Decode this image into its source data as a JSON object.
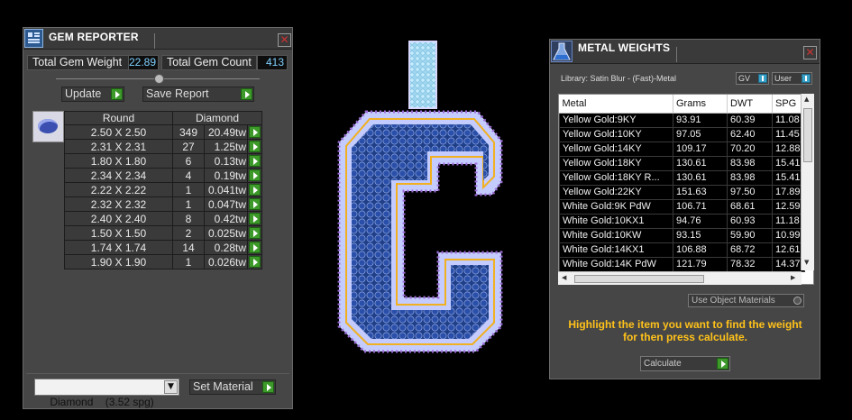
{
  "gem_reporter": {
    "title": "GEM REPORTER",
    "close_glyph": "✕",
    "total_weight_label": "Total Gem Weight",
    "total_weight_value": "22.89",
    "total_count_label": "Total Gem Count",
    "total_count_value": "413",
    "update_label": "Update",
    "save_report_label": "Save Report",
    "table_headers": [
      "Round",
      "Diamond"
    ],
    "rows": [
      {
        "size": "2.50 X 2.50",
        "count": "349",
        "weight": "20.49tw"
      },
      {
        "size": "2.31 X 2.31",
        "count": "27",
        "weight": "1.25tw"
      },
      {
        "size": "1.80 X 1.80",
        "count": "6",
        "weight": "0.13tw"
      },
      {
        "size": "2.34 X 2.34",
        "count": "4",
        "weight": "0.19tw"
      },
      {
        "size": "2.22 X 2.22",
        "count": "1",
        "weight": "0.041tw"
      },
      {
        "size": "2.32 X 2.32",
        "count": "1",
        "weight": "0.047tw"
      },
      {
        "size": "2.40 X 2.40",
        "count": "8",
        "weight": "0.42tw"
      },
      {
        "size": "1.50 X 1.50",
        "count": "2",
        "weight": "0.025tw"
      },
      {
        "size": "1.74 X 1.74",
        "count": "14",
        "weight": "0.28tw"
      },
      {
        "size": "1.90 X 1.90",
        "count": "1",
        "weight": "0.026tw"
      }
    ],
    "material_select_value": "Diamond    (3.52 spg)",
    "set_material_label": "Set Material"
  },
  "metal_weights": {
    "title": "METAL WEIGHTS",
    "close_glyph": "✕",
    "library_label": "Library: Satin Blur - (Fast)-Metal",
    "gv_label": "GV",
    "user_label": "User",
    "columns": [
      "Metal",
      "Grams",
      "DWT",
      "SPG"
    ],
    "rows": [
      {
        "metal": "Yellow Gold:9KY",
        "grams": "93.91",
        "dwt": "60.39",
        "spg": "11.08"
      },
      {
        "metal": "Yellow Gold:10KY",
        "grams": "97.05",
        "dwt": "62.40",
        "spg": "11.45"
      },
      {
        "metal": "Yellow Gold:14KY",
        "grams": "109.17",
        "dwt": "70.20",
        "spg": "12.88"
      },
      {
        "metal": "Yellow Gold:18KY",
        "grams": "130.61",
        "dwt": "83.98",
        "spg": "15.41"
      },
      {
        "metal": "Yellow Gold:18KY R...",
        "grams": "130.61",
        "dwt": "83.98",
        "spg": "15.41"
      },
      {
        "metal": "Yellow Gold:22KY",
        "grams": "151.63",
        "dwt": "97.50",
        "spg": "17.89"
      },
      {
        "metal": "White Gold:9K PdW",
        "grams": "106.71",
        "dwt": "68.61",
        "spg": "12.59"
      },
      {
        "metal": "White Gold:10KX1",
        "grams": "94.76",
        "dwt": "60.93",
        "spg": "11.18"
      },
      {
        "metal": "White Gold:10KW",
        "grams": "93.15",
        "dwt": "59.90",
        "spg": "10.99"
      },
      {
        "metal": "White Gold:14KX1",
        "grams": "106.88",
        "dwt": "68.72",
        "spg": "12.61"
      },
      {
        "metal": "White Gold:14K PdW",
        "grams": "121.79",
        "dwt": "78.32",
        "spg": "14.37"
      }
    ],
    "use_object_materials_label": "Use Object Materials",
    "hint": "Highlight the item you want to find the weight for then press calculate.",
    "calculate_label": "Calculate"
  },
  "colors": {
    "panel_bg": "#464646",
    "hint_text": "#ffc21a",
    "value_text": "#7fd0ff",
    "go_button": "#3d9a2a",
    "gem_blue": "#1f3f88",
    "gem_outline": "#b8c9ff",
    "gold_border": "#f0b020"
  },
  "icons": {
    "gem_reporter_logo": "gem-reporter-logo-icon",
    "metal_weights_logo": "metal-weights-flask-icon",
    "close": "close-icon",
    "go": "play-arrow-icon",
    "dropdown": "chevron-down-icon"
  }
}
